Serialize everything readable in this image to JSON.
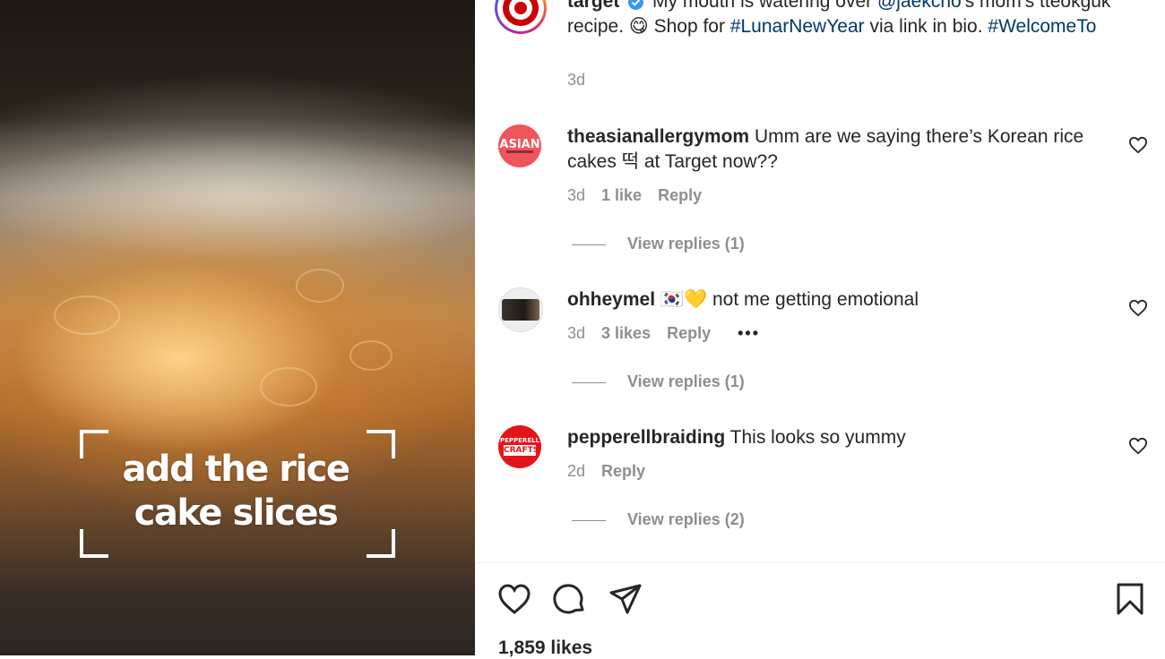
{
  "video": {
    "caption_lines": [
      "add the rice",
      "cake slices"
    ]
  },
  "post": {
    "username": "target",
    "text_before_mention": "My mouth is watering over ",
    "mention": "@jaekcho",
    "text_after_mention": "'s mom's tteokguk recipe. 😋 Shop for ",
    "hashtag1": "#LunarNewYear",
    "text_between": " via link in bio. ",
    "hashtag2": "#WelcomeTo",
    "time": "3d"
  },
  "comments": [
    {
      "username": "theasianallergymom",
      "text": "Umm are we saying there’s Korean rice cakes 떡 at Target now??",
      "avatar_text": "ASIAN",
      "time": "3d",
      "likes": "1 like",
      "reply_label": "Reply",
      "view_replies": "View replies (1)"
    },
    {
      "username": "ohheymel",
      "text": "🇰🇷💛 not me getting emotional",
      "time": "3d",
      "likes": "3 likes",
      "reply_label": "Reply",
      "more_label": "•••",
      "view_replies": "View replies (1)"
    },
    {
      "username": "pepperellbraiding",
      "text": "This looks so yummy",
      "avatar_text_top": "PEPPERELL",
      "avatar_text_bottom": "CRAFTS",
      "time": "2d",
      "reply_label": "Reply",
      "view_replies": "View replies (2)"
    }
  ],
  "actions": {
    "icons": [
      "heart-icon",
      "comment-icon",
      "share-icon",
      "bookmark-icon"
    ]
  },
  "likes_count": "1,859 likes",
  "colors": {
    "link": "#00376b",
    "meta": "#8e8e8e",
    "target_red": "#cc0000"
  }
}
